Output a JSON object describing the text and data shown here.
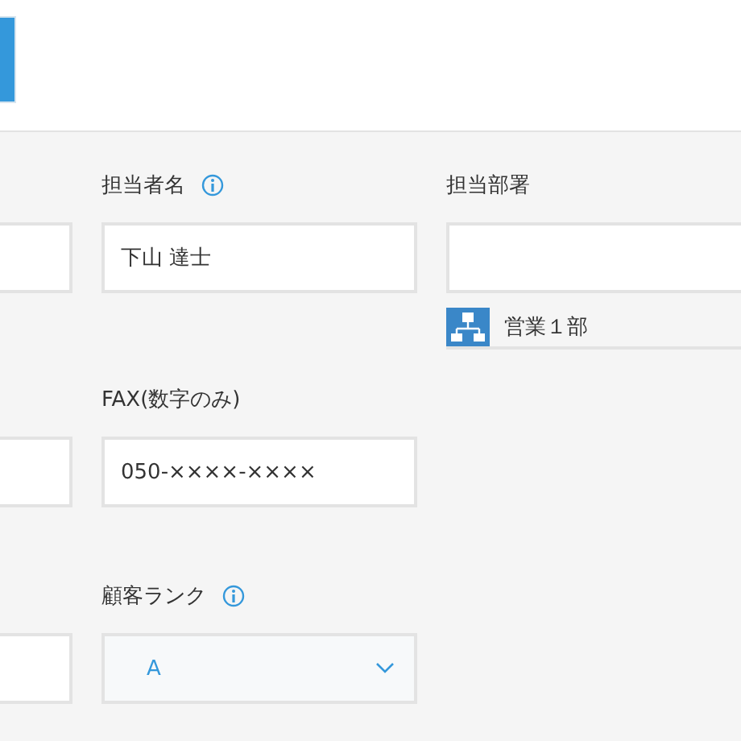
{
  "rows": [
    {
      "cells": [
        {
          "kind": "text"
        },
        {
          "kind": "text",
          "label": "担当者名",
          "info": true,
          "value": "下山 達士"
        },
        {
          "kind": "text",
          "label": "担当部署",
          "chips": [
            {
              "text": "営業１部"
            }
          ]
        }
      ]
    },
    {
      "cells": [
        {
          "kind": "text"
        },
        {
          "kind": "text",
          "label": "FAX(数字のみ)",
          "value": "050-××××-××××"
        }
      ]
    },
    {
      "cells": [
        {
          "kind": "text"
        },
        {
          "kind": "dropdown",
          "label": "顧客ランク",
          "info": true,
          "value": "A"
        }
      ]
    }
  ]
}
